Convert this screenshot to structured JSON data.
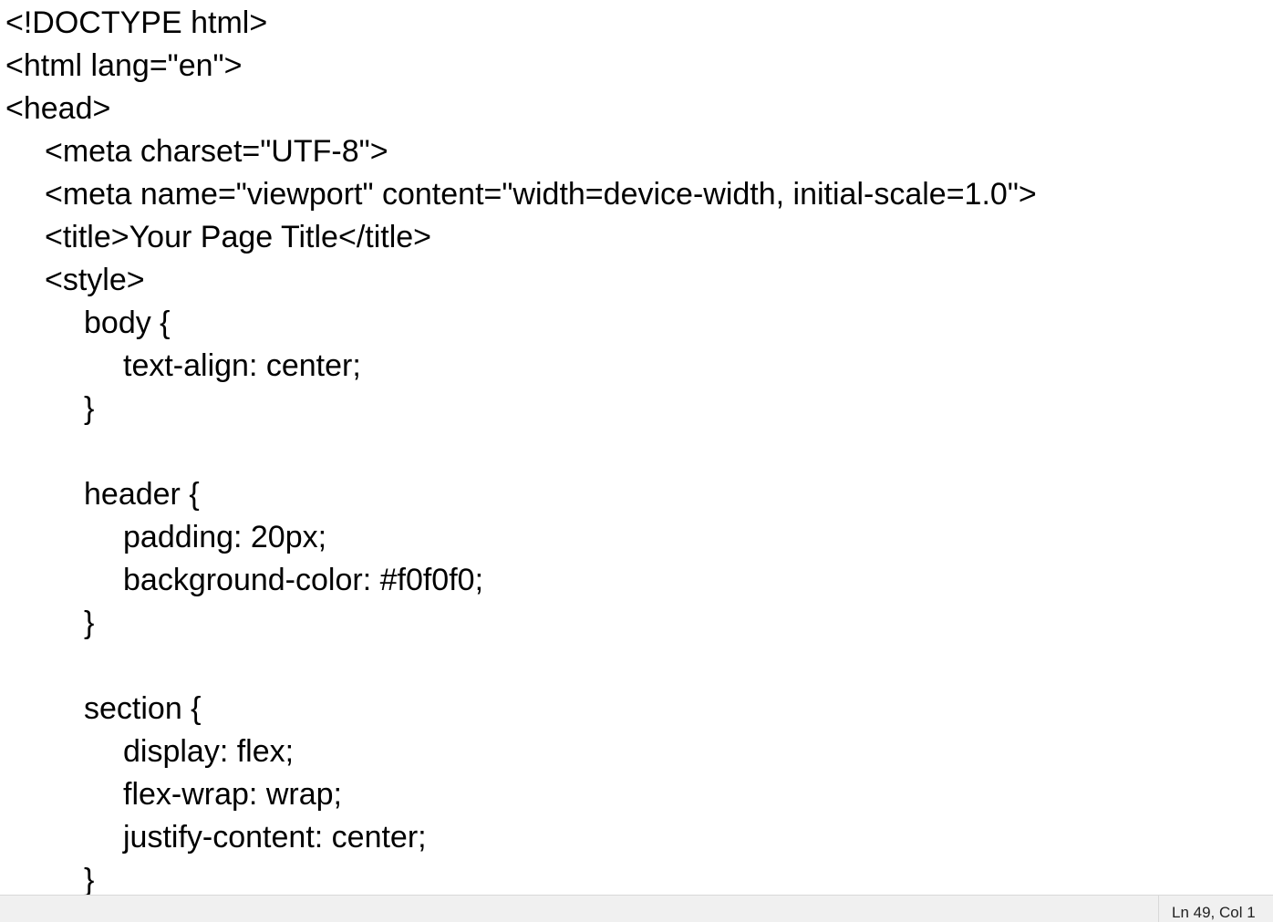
{
  "editor": {
    "lines": [
      "<!DOCTYPE html>",
      "<html lang=\"en\">",
      "<head>",
      "<meta charset=\"UTF-8\">",
      "<meta name=\"viewport\" content=\"width=device-width, initial-scale=1.0\">",
      "<title>Your Page Title</title>",
      "<style>",
      "body {",
      "text-align: center;",
      "}",
      "",
      "header {",
      "padding: 20px;",
      "background-color: #f0f0f0;",
      "}",
      "",
      "section {",
      "display: flex;",
      "flex-wrap: wrap;",
      "justify-content: center;",
      "}"
    ]
  },
  "status_bar": {
    "position": "Ln 49, Col 1"
  }
}
